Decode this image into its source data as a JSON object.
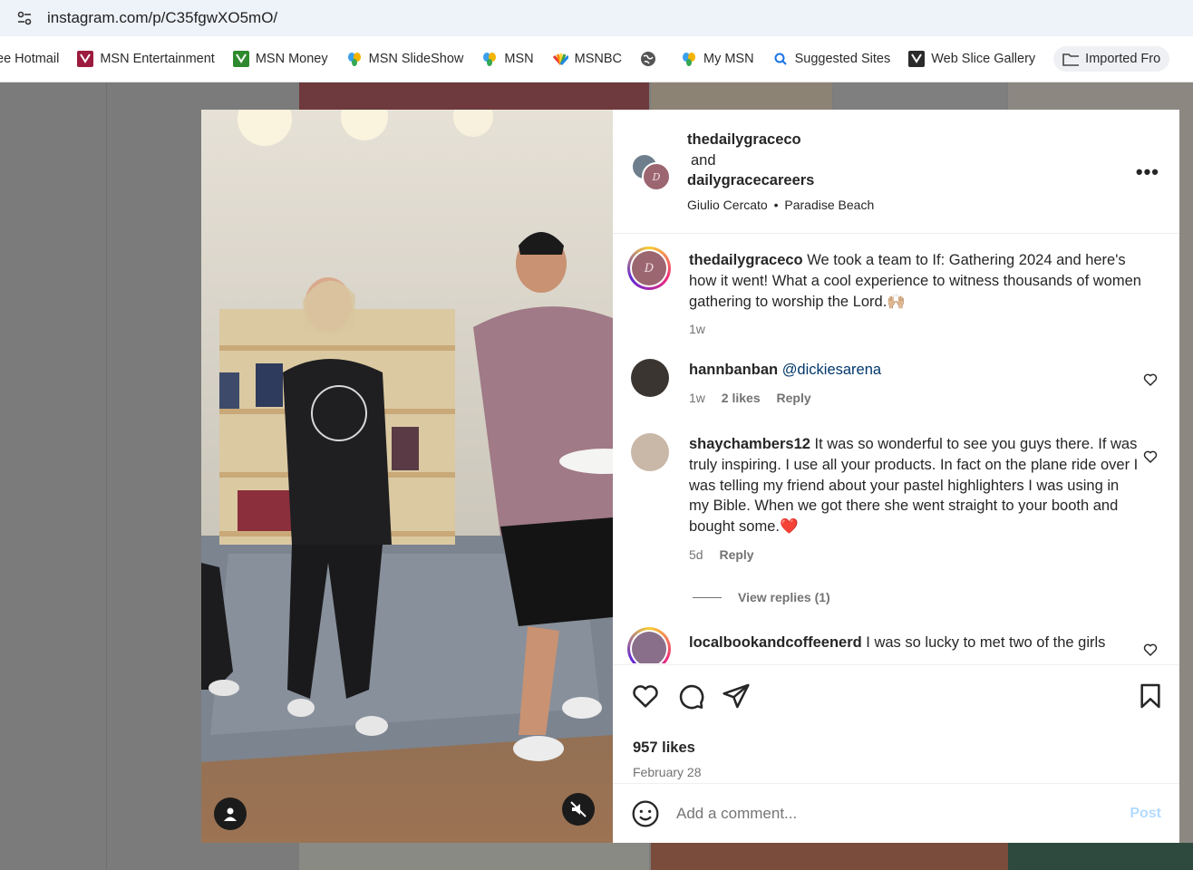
{
  "browser": {
    "url": "instagram.com/p/C35fgwXO5mO/"
  },
  "bookmarks": [
    {
      "label": "ee Hotmail",
      "icon": "msn-icon"
    },
    {
      "label": "MSN Entertainment",
      "icon": "msn-icon"
    },
    {
      "label": "MSN Money",
      "icon": "msn-icon"
    },
    {
      "label": "MSN SlideShow",
      "icon": "msn-butterfly-icon"
    },
    {
      "label": "MSN",
      "icon": "msn-butterfly-icon"
    },
    {
      "label": "MSNBC",
      "icon": "msnbc-peacock-icon"
    },
    {
      "label": "",
      "icon": "globe-icon"
    },
    {
      "label": "My MSN",
      "icon": "msn-butterfly-icon"
    },
    {
      "label": "Suggested Sites",
      "icon": "search-icon"
    },
    {
      "label": "Web Slice Gallery",
      "icon": "msn-icon"
    },
    {
      "label": "Imported Fro",
      "icon": "folder-icon"
    }
  ],
  "post": {
    "author1": "thedailygraceco",
    "joiner": "and",
    "author2": "dailygracecareers",
    "audio": "Giulio Cercato",
    "dot": "•",
    "location": "Paradise Beach",
    "more": "•••"
  },
  "caption": {
    "user": "thedailygraceco",
    "text": "We took a team to If: Gathering 2024 and here's how it went! What a cool experience to witness thousands of women gathering to worship the Lord.🙌🏼",
    "time": "1w"
  },
  "comments": [
    {
      "user": "hannbanban",
      "text": "@dickiesarena",
      "time": "1w",
      "likes": "2 likes",
      "reply": "Reply"
    },
    {
      "user": "shaychambers12",
      "text": "It was so wonderful to see you guys there. If was truly inspiring. I use all your products. In fact on the plane ride over I was telling my friend about your pastel highlighters I was using in my Bible. When we got there she went straight to your booth and bought some.❤️",
      "time": "5d",
      "reply": "Reply",
      "view_replies": "View replies (1)"
    },
    {
      "user": "localbookandcoffeenerd",
      "text": "I was so lucky to met two of the girls"
    }
  ],
  "likes": "957 likes",
  "date": "February 28",
  "comment_box": {
    "placeholder": "Add a comment...",
    "post": "Post"
  },
  "colors": {
    "accent": "#0095f6",
    "post_disabled": "#b3dbff",
    "heart_red": "#ed4956"
  }
}
